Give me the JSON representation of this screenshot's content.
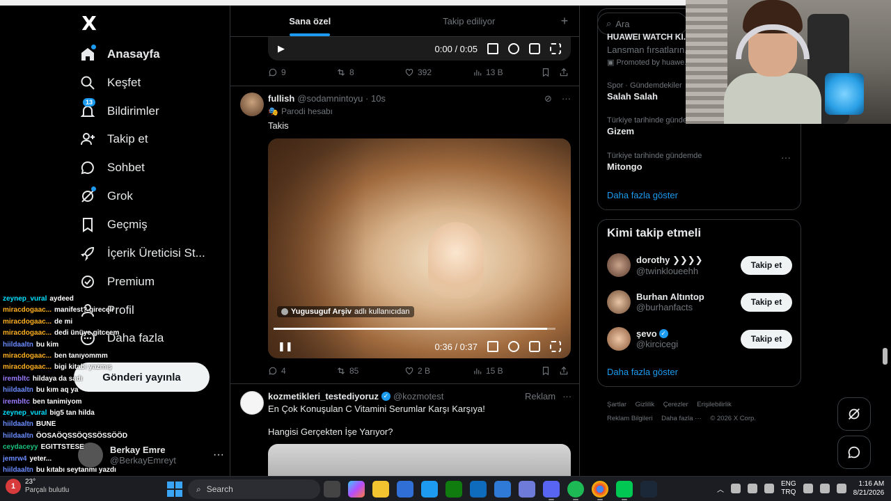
{
  "nav": {
    "logo": "X",
    "items": [
      {
        "label": "Anasayfa",
        "icon": "home-icon",
        "active": true,
        "dot": true
      },
      {
        "label": "Keşfet",
        "icon": "search-icon"
      },
      {
        "label": "Bildirimler",
        "icon": "bell-icon",
        "badge": "13"
      },
      {
        "label": "Takip et",
        "icon": "add-user-icon"
      },
      {
        "label": "Sohbet",
        "icon": "chat-icon"
      },
      {
        "label": "Grok",
        "icon": "grok-icon",
        "dot": true
      },
      {
        "label": "Geçmiş",
        "icon": "bookmark-icon"
      },
      {
        "label": "İçerik Üreticisi St...",
        "icon": "rocket-icon"
      },
      {
        "label": "Premium",
        "icon": "premium-icon"
      },
      {
        "label": "Profil",
        "icon": "profile-icon"
      },
      {
        "label": "Daha fazla",
        "icon": "more-icon"
      }
    ],
    "post_button": "Gönderi yayınla",
    "account": {
      "name": "Berkay Emre",
      "handle": "@BerkayEmreyt"
    }
  },
  "chat": [
    {
      "user": "zeynep_vural",
      "msg": "aydeed",
      "color": "#00e0ff"
    },
    {
      "user": "miracdogaac...",
      "msg": "manifest? gireceli",
      "color": "#ffb020"
    },
    {
      "user": "miracdogaac...",
      "msg": "de mi",
      "color": "#ffb020"
    },
    {
      "user": "miracdogaac...",
      "msg": "dedi ünüye gitceem",
      "color": "#ffb020"
    },
    {
      "user": "hiildaaltn",
      "msg": "bu kim",
      "color": "#6a8cff"
    },
    {
      "user": "miracdogaac...",
      "msg": "ben tanıyommm",
      "color": "#ffb020"
    },
    {
      "user": "miracdogaac...",
      "msg": "bigi kitabı yazmış",
      "color": "#ffb020"
    },
    {
      "user": "irembltc",
      "msg": "hildaya da sadı",
      "color": "#9b7bff"
    },
    {
      "user": "hiildaaltn",
      "msg": "bu kım aq ya",
      "color": "#6a8cff"
    },
    {
      "user": "irembltc",
      "msg": "ben tanimiyom",
      "color": "#9b7bff"
    },
    {
      "user": "zeynep_vural",
      "msg": "big5 tan hilda",
      "color": "#00e0ff"
    },
    {
      "user": "hiildaaltn",
      "msg": "BUNE",
      "color": "#6a8cff"
    },
    {
      "user": "hiildaaltn",
      "msg": "ÖOSAÖQSSÖQSSÖSSÖÖD",
      "color": "#6a8cff"
    },
    {
      "user": "ceydaceyy",
      "msg": "EGITTSTESE",
      "color": "#19c37d"
    },
    {
      "user": "jemrw4",
      "msg": "yeter...",
      "color": "#6a8cff"
    },
    {
      "user": "hiildaaltn",
      "msg": "bu kıtabı seytanmı yazdı",
      "color": "#6a8cff"
    }
  ],
  "tabs": {
    "for_you": "Sana özel",
    "following": "Takip ediliyor",
    "add": "+"
  },
  "post1": {
    "time": "0:00 / 0:05",
    "replies": "9",
    "reposts": "8",
    "likes": "392",
    "views": "13 B"
  },
  "post2": {
    "name": "fullish",
    "handle": "@sodamnintoyu · 10s",
    "label": "Parodi hesabı",
    "text": "Takis",
    "video_owner": "Yugusuguf Arşiv",
    "video_owner_suffix": "adlı kullanıcıdan",
    "time": "0:36 / 0:37",
    "progress": 0.97,
    "replies": "4",
    "reposts": "85",
    "likes": "2 B",
    "views": "15 B"
  },
  "post3": {
    "name": "kozmetikleri_testediyoruz",
    "handle": "@kozmotest",
    "promo": "Reklam",
    "line1": "En Çok Konuşulan C Vitamini Serumlar Karşı Karşıya!",
    "line2": "Hangisi Gerçekten İşe Yarıyor?"
  },
  "right": {
    "search_placeholder": "Ara",
    "promo_title": "HUAWEI WATCH KI...",
    "promo_sub": "Lansman fırsatların...",
    "promo_by": "Promoted by huawe...",
    "trends": [
      {
        "cat": "Spor · Gündemdekiler",
        "title": "Salah Salah"
      },
      {
        "cat": "Türkiye tarihinde gündem...",
        "title": "Gizem"
      },
      {
        "cat": "Türkiye tarihinde gündemde",
        "title": "Mitongo"
      }
    ],
    "show_more": "Daha fazla göster",
    "wtf_title": "Kimi takip etmeli",
    "wtf": [
      {
        "name": "dorothy ❯❯❯❯",
        "handle": "@twinkloueehh",
        "btn": "Takip et",
        "verified": false
      },
      {
        "name": "Burhan Altıntop",
        "handle": "@burhanfacts",
        "btn": "Takip et",
        "verified": false
      },
      {
        "name": "şevo",
        "handle": "@kircicegi",
        "btn": "Takip et",
        "verified": true
      }
    ],
    "show_more2": "Daha fazla göster",
    "footer": [
      "Şartlar",
      "Gizlilik",
      "Çerezler",
      "Erişilebilirlik",
      "Reklam Bilgileri",
      "Daha fazla ···",
      "© 2026 X Corp."
    ]
  },
  "taskbar": {
    "weather_temp": "23°",
    "weather_desc": "Parçalı bulutlu",
    "notif": "1",
    "search": "Search",
    "lang1": "ENG",
    "lang2": "TRQ",
    "time": "1:16 AM",
    "date": "8/21/2026"
  },
  "colors": {
    "accent": "#1d9bf0",
    "bg": "#000000",
    "border": "#2f3336",
    "muted": "#71767b"
  }
}
